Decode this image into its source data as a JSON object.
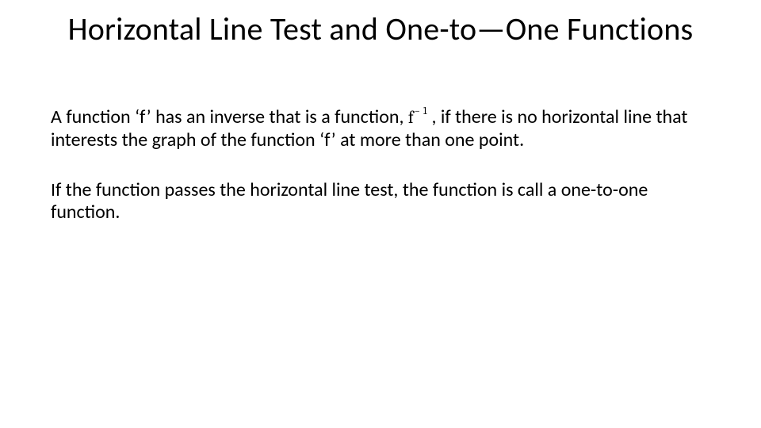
{
  "title": "Horizontal Line Test and One-to—One Functions",
  "para1": {
    "pre": "A function ‘f’ has an inverse that is a function, ",
    "finv_base": "f",
    "finv_sup": "− 1",
    "post": " , if there is no horizontal line that interests the graph of the function ‘f’ at more than one point."
  },
  "para2": "If the function passes the horizontal line test, the function is call a one-to-one function."
}
